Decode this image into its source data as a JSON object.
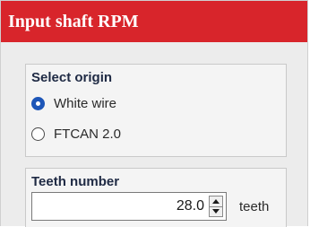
{
  "header": {
    "title": "Input shaft RPM",
    "color": "#d8252b"
  },
  "origin_group": {
    "title": "Select origin",
    "options": [
      {
        "label": "White wire",
        "selected": true
      },
      {
        "label": "FTCAN 2.0",
        "selected": false
      }
    ]
  },
  "teeth_group": {
    "title": "Teeth number",
    "value": "28.0",
    "unit": "teeth"
  }
}
